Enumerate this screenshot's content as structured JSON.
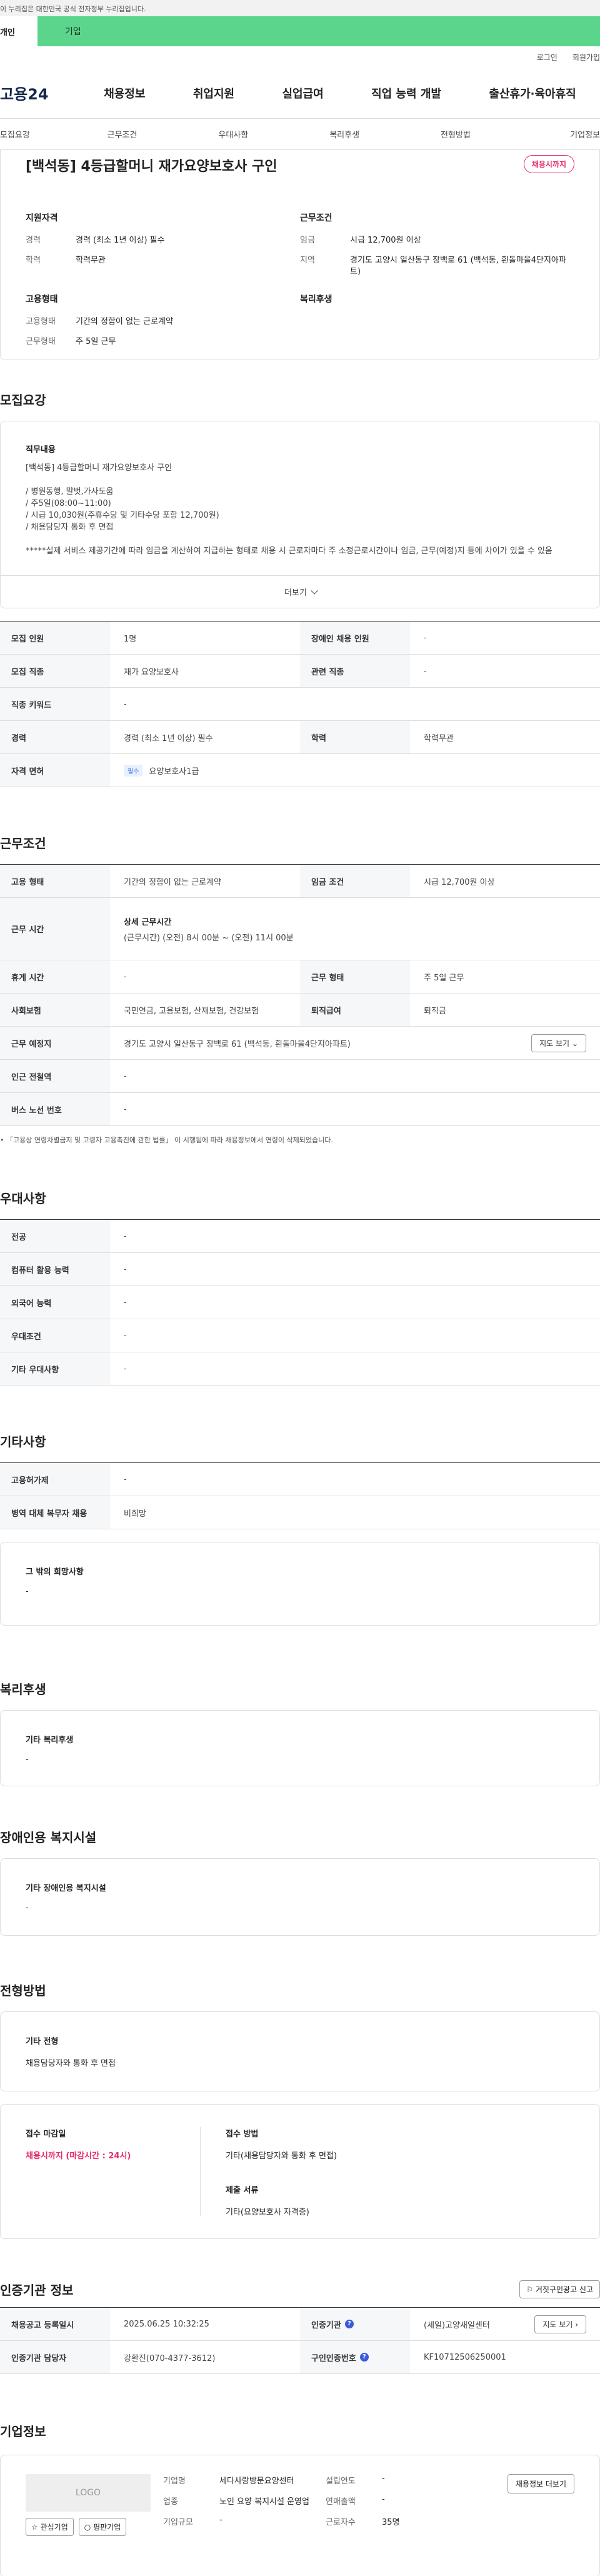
{
  "gov_bar": {
    "text": "이 누리집은 대한민국 공식 전자정부 누리집입니다."
  },
  "top_tabs": {
    "person": "개인",
    "company": "기업"
  },
  "util": {
    "login": "로그인",
    "join": "회원가입"
  },
  "gnb": {
    "logo": "고용24",
    "menu": [
      "채용정보",
      "취업지원",
      "실업급여",
      "직업 능력 개발",
      "출산휴가·육아휴직"
    ]
  },
  "anchor_nav": [
    "모집요강",
    "근무조건",
    "우대사항",
    "복리후생",
    "전형방법",
    "기업정보"
  ],
  "summary": {
    "title": "[백석동] 4등급할머니 재가요양보호사 구인",
    "badge": "채용시까지",
    "qual_heading": "지원자격",
    "career_k": "경력",
    "career_v": "경력 (최소 1년 이상) 필수",
    "edu_k": "학력",
    "edu_v": "학력무관",
    "cond_heading": "근무조건",
    "wage_k": "임금",
    "wage_v": "시급 12,700원 이상",
    "region_k": "지역",
    "region_v": "경기도 고양시 일산동구 장백로 61 (백석동, 흰돌마을4단지아파트)",
    "emp_heading": "고용형태",
    "emptype_k": "고용형태",
    "emptype_v": "기간의 정함이 없는 근로계약",
    "worktype_k": "근무형태",
    "worktype_v": "주 5일 근무",
    "welfare_heading": "복리후생"
  },
  "recruit": {
    "title": "모집요강",
    "job_heading": "직무내용",
    "job_lines": [
      "[백석동] 4등급할머니 재가요양보호사 구인",
      "",
      "/ 병원동행, 말벗,가사도움",
      "/ 주5일(08:00~11:00)",
      "/ 시급 10,030원(주휴수당 및 기타수당 포함 12,700원)",
      "/ 채용담당자 통화 후 면접",
      "",
      "*****실제 서비스 제공기간에 따라 임금을 계산하여 지급하는 형태로 채용 시 근로자마다 주 소정근로시간이나 임금, 근무(예정)지 등에 차이가 있을 수 있음"
    ],
    "more": "더보기",
    "rows": [
      {
        "k1": "모집 인원",
        "v1": "1명",
        "k2": "장애인 채용 인원",
        "v2": "-"
      },
      {
        "k1": "모집 직종",
        "v1": "재가 요양보호사",
        "k2": "관련 직종",
        "v2": "-"
      },
      {
        "k1": "직종 키워드",
        "v1": "-"
      },
      {
        "k1": "경력",
        "v1": "경력 (최소 1년 이상) 필수",
        "k2": "학력",
        "v2": "학력무관"
      },
      {
        "k1": "자격 면허",
        "tag": "필수",
        "v1": "요양보호사1급"
      }
    ]
  },
  "work": {
    "title": "근무조건",
    "emp_k": "고용 형태",
    "emp_v": "기간의 정함이 없는 근로계약",
    "wage_k": "임금 조건",
    "wage_v": "시급 12,700원 이상",
    "time_k": "근무 시간",
    "time_head": "상세 근무시간",
    "time_v": "(근무시간) (오전) 8시 00분 ~ (오전) 11시 00분",
    "rest_k": "휴게 시간",
    "rest_v": "-",
    "form_k": "근무 형태",
    "form_v": "주 5일 근무",
    "ins_k": "사회보험",
    "ins_v": "국민연금, 고용보험, 산재보험, 건강보험",
    "ret_k": "퇴직급여",
    "ret_v": "퇴직금",
    "place_k": "근무 예정지",
    "place_v": "경기도 고양시 일산동구 장백로 61 (백석동, 흰돌마을4단지아파트)",
    "map_btn": "지도 보기",
    "subway_k": "인근 전철역",
    "subway_v": "-",
    "bus_k": "버스 노선 번호",
    "bus_v": "-",
    "footnote": "「고용상 연령차별금지 및 고령자 고용촉진에 관한 법률」 이 시행됨에 따라 채용정보에서 연령이 삭제되었습니다."
  },
  "pref": {
    "title": "우대사항",
    "rows": [
      {
        "k": "전공",
        "v": "-"
      },
      {
        "k": "컴퓨터 활용 능력",
        "v": "-"
      },
      {
        "k": "외국어 능력",
        "v": "-"
      },
      {
        "k": "우대조건",
        "v": "-"
      },
      {
        "k": "기타 우대사항",
        "v": "-"
      }
    ]
  },
  "etc": {
    "title": "기타사항",
    "rows": [
      {
        "k": "고용허가제",
        "v": "-"
      },
      {
        "k": "병역 대체 복무자 채용",
        "v": "비희망"
      }
    ],
    "wish_heading": "그 밖의 희망사항",
    "wish_v": "-"
  },
  "welfare": {
    "title": "복리후생",
    "heading": "기타 복리후생",
    "v": "-"
  },
  "disability": {
    "title": "장애인용 복지시설",
    "heading": "기타 장애인용 복지시설",
    "v": "-"
  },
  "selection": {
    "title": "전형방법",
    "heading": "기타 전형",
    "v": "채용담당자와 통화 후 면접",
    "deadline_k": "접수 마감일",
    "deadline_v": "채용시까지 (마감시간 : 24시)",
    "method_k": "접수 방법",
    "method_v": "기타(채용담당자와 통화 후 면접)",
    "docs_k": "제출 서류",
    "docs_v": "기타(요양보호사 자격증)"
  },
  "org": {
    "title": "인증기관 정보",
    "report_btn": "거짓구인광고 신고",
    "reg_k": "채용공고 등록일시",
    "reg_v": "2025.06.25 10:32:25",
    "agency_k": "인증기관",
    "agency_v": "(세일)고양새일센터",
    "map_btn": "지도 보기",
    "manager_k": "인증기관 담당자",
    "manager_v": "강환진(070-4377-3612)",
    "notice_k": "구인인증번호",
    "notice_v": "KF10712506250001"
  },
  "company": {
    "title": "기업정보",
    "logo": "LOGO",
    "fav_btn": "관심기업",
    "review_btn": "평판기업",
    "name_k": "기업명",
    "name_v": "세다사랑방문요양센터",
    "ind_k": "업종",
    "ind_v": "노인 요양 복지시설 운영업",
    "size_k": "기업규모",
    "size_v": "-",
    "found_k": "설립연도",
    "found_v": "-",
    "sales_k": "연매출액",
    "sales_v": "-",
    "emp_k": "근로자수",
    "emp_v": "35명",
    "more_btn": "채용정보 더보기"
  }
}
